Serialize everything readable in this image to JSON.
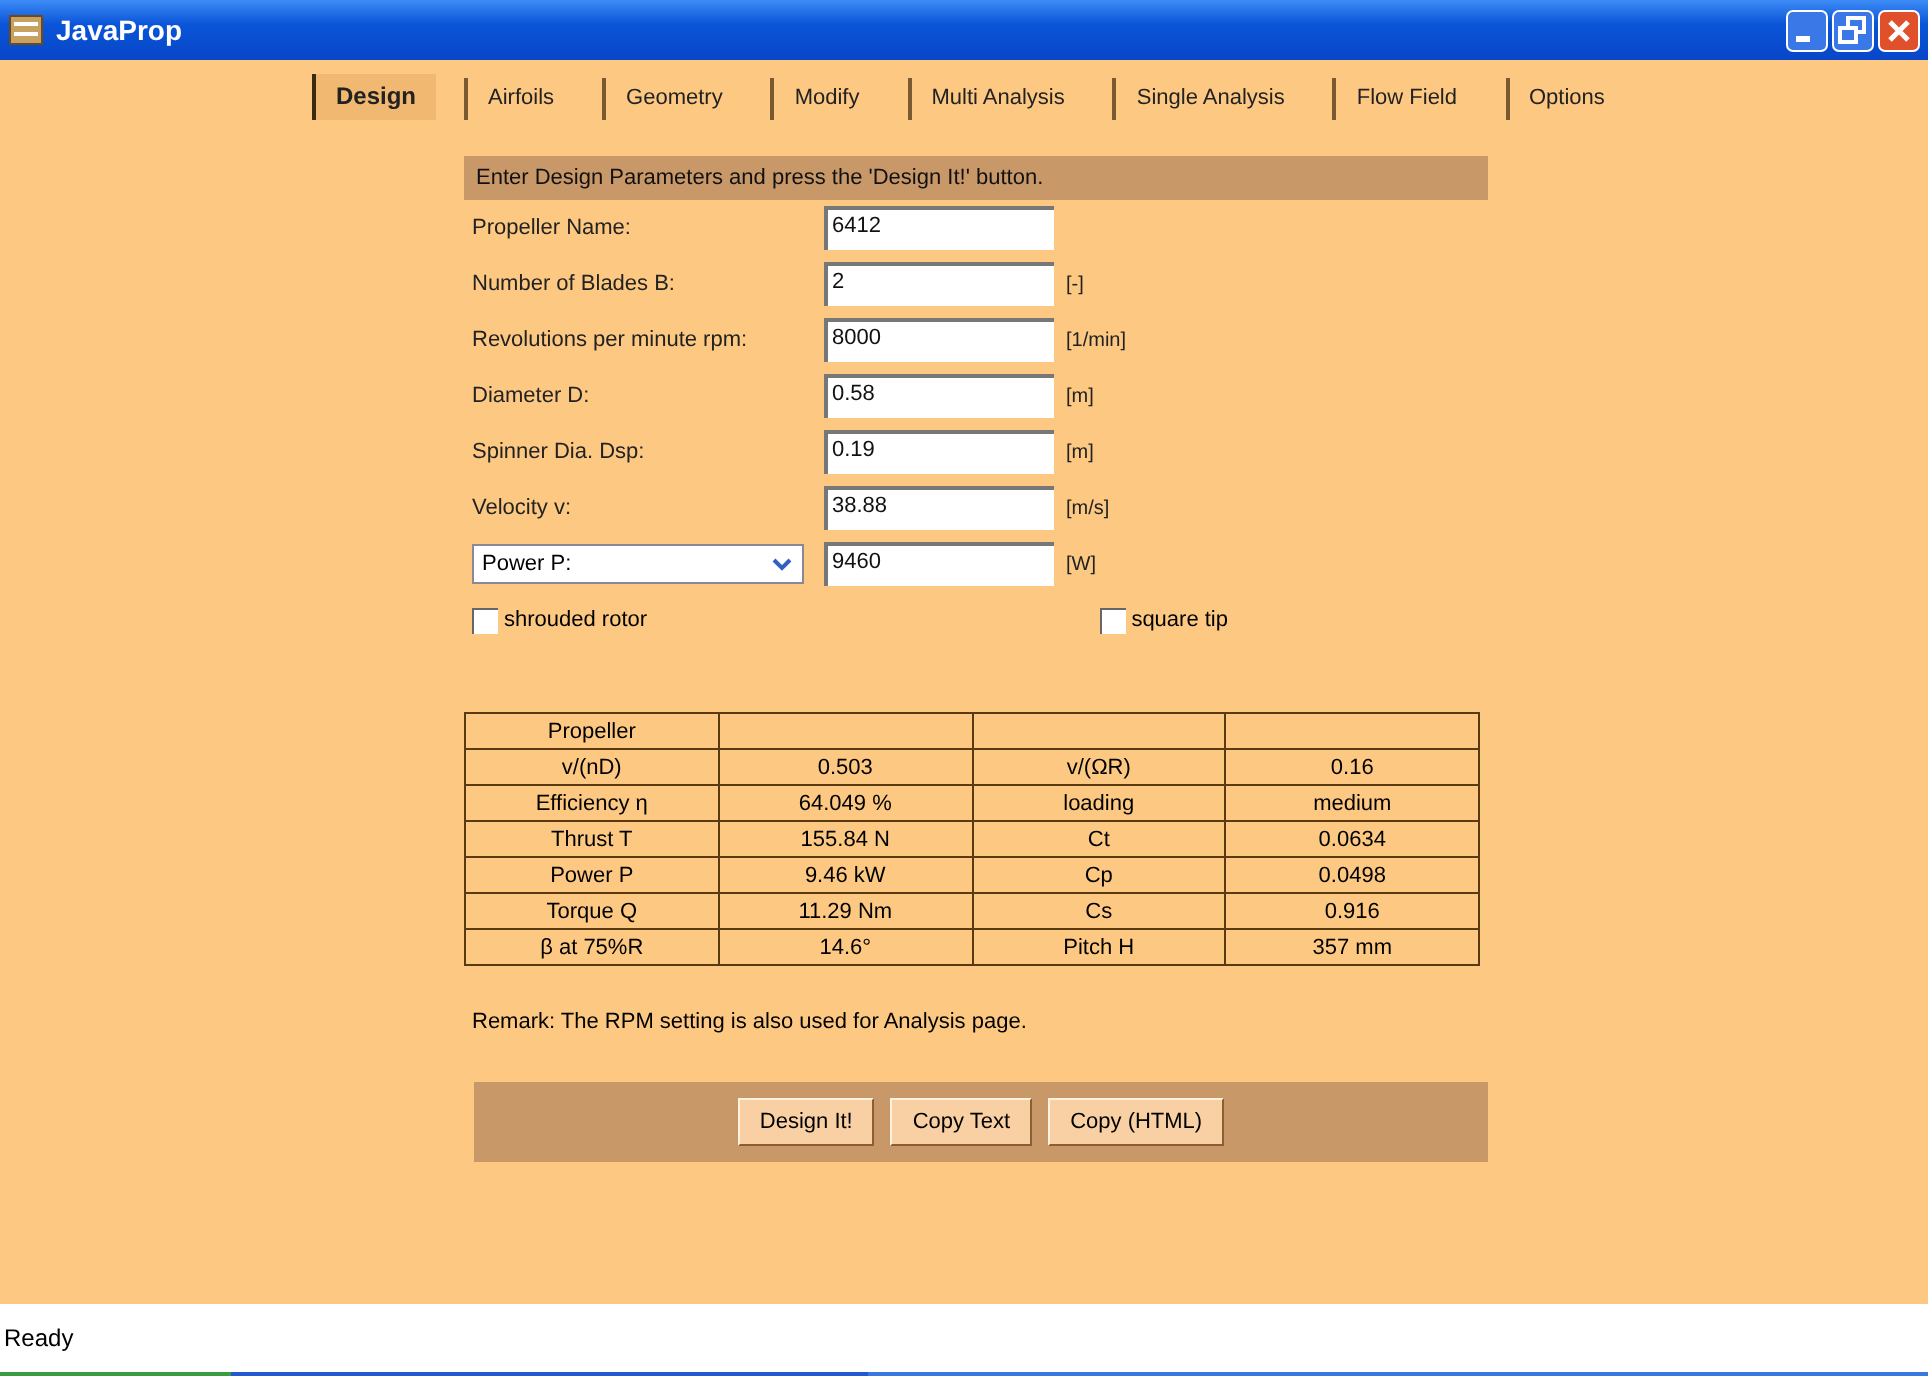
{
  "window": {
    "title": "JavaProp"
  },
  "tabs": [
    {
      "label": "Design",
      "selected": true
    },
    {
      "label": "Airfoils",
      "selected": false
    },
    {
      "label": "Geometry",
      "selected": false
    },
    {
      "label": "Modify",
      "selected": false
    },
    {
      "label": "Multi Analysis",
      "selected": false
    },
    {
      "label": "Single Analysis",
      "selected": false
    },
    {
      "label": "Flow Field",
      "selected": false
    },
    {
      "label": "Options",
      "selected": false
    }
  ],
  "instruction": "Enter Design Parameters and press the 'Design It!' button.",
  "fields": [
    {
      "kind": "label",
      "label": "Propeller Name:",
      "value": "6412"
    },
    {
      "kind": "label",
      "label": "Number of Blades  B:",
      "value": "2",
      "unit": "[-]"
    },
    {
      "kind": "label",
      "label": "Revolutions per minute  rpm:",
      "value": "8000",
      "unit": "[1/min]"
    },
    {
      "kind": "label",
      "label": "Diameter  D:",
      "value": "0.58",
      "unit": "[m]"
    },
    {
      "kind": "label",
      "label": "Spinner Dia.  Dsp:",
      "value": "0.19",
      "unit": "[m]"
    },
    {
      "kind": "label",
      "label": "Velocity  v:",
      "value": "38.88",
      "unit": "[m/s]"
    },
    {
      "kind": "dropdown",
      "label": "Power  P:",
      "value": "9460",
      "unit": "[W]"
    }
  ],
  "checkboxes": [
    {
      "label": "shrouded rotor",
      "checked": false
    },
    {
      "label": "square tip",
      "checked": false
    }
  ],
  "table": {
    "header": [
      "Propeller"
    ],
    "rows": [
      [
        "v/(nD)",
        "0.503",
        "v/(ΩR)",
        "0.16"
      ],
      [
        "Efficiency η",
        "64.049 %",
        "loading",
        "medium"
      ],
      [
        "Thrust  T",
        "155.84 N",
        "Ct",
        "0.0634"
      ],
      [
        "Power  P",
        "9.46 kW",
        "Cp",
        "0.0498"
      ],
      [
        "Torque  Q",
        "11.29 Nm",
        "Cs",
        "0.916"
      ],
      [
        "β at 75%R",
        "14.6°",
        "Pitch H",
        "357 mm"
      ]
    ]
  },
  "remark": "Remark: The RPM setting is also used for Analysis page.",
  "buttons": [
    "Design It!",
    "Copy Text",
    "Copy (HTML)"
  ],
  "status_bar": "Ready"
}
